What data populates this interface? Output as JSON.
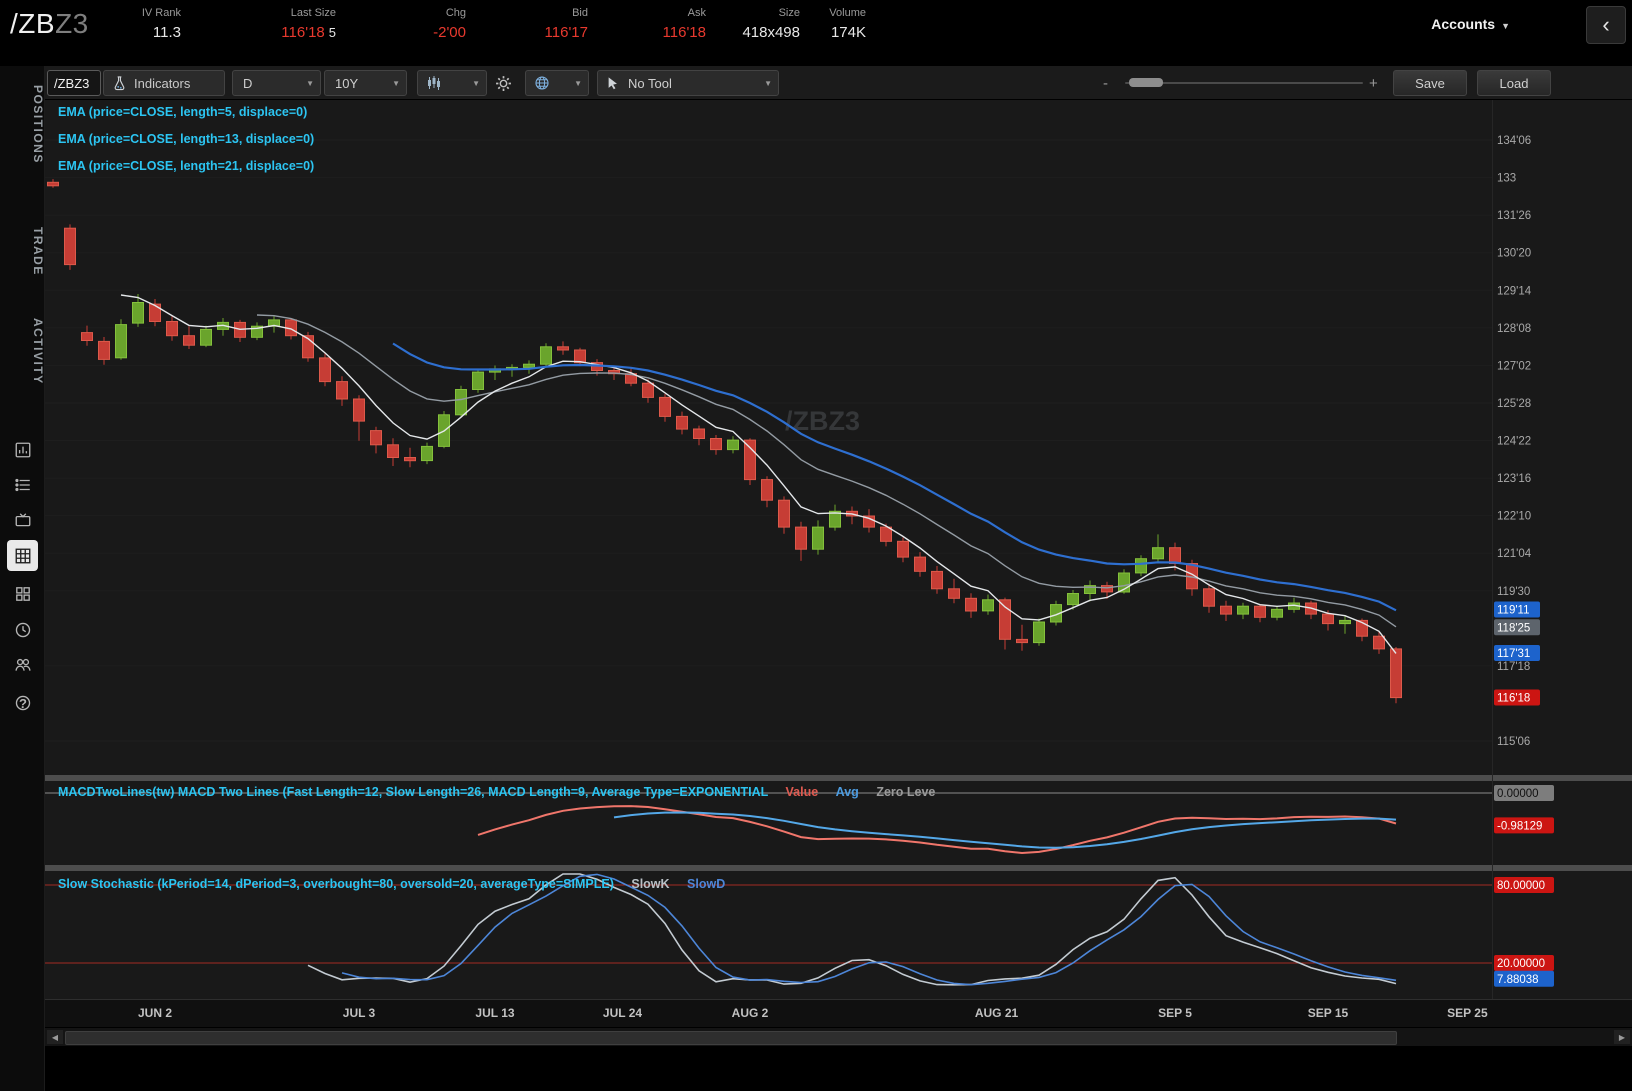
{
  "header": {
    "symbol_main": "/ZB",
    "symbol_suffix": "Z3",
    "stats": [
      {
        "label": "IV Rank",
        "value": "11.3"
      },
      {
        "label": "Last Size",
        "value": "116'18",
        "value2": "5"
      },
      {
        "label": "Chg",
        "value": "-2'00"
      },
      {
        "label": "Bid",
        "value": "116'17"
      },
      {
        "label": "Ask",
        "value": "116'18"
      },
      {
        "label": "Size",
        "value": "418x498"
      },
      {
        "label": "Volume",
        "value": "174K"
      }
    ],
    "accounts_label": "Accounts"
  },
  "icons": {
    "caret": "▼",
    "chevron_left": "‹",
    "scroll_left": "◀",
    "scroll_right": "▶",
    "zoom_minus": "-",
    "zoom_plus": "+"
  },
  "sidebar": {
    "tabs": [
      "POSITIONS",
      "TRADE",
      "ACTIVITY"
    ],
    "icon_names": [
      "chart-report-icon",
      "order-list-icon",
      "tv-icon",
      "chart-grid-icon",
      "apps-icon",
      "history-clock-icon",
      "community-icon",
      "help-icon"
    ]
  },
  "toolbar": {
    "symbol_input": "/ZBZ3",
    "indicators_label": "Indicators",
    "aggregation": "D",
    "range": "10Y",
    "tool_label": "No Tool",
    "save_label": "Save",
    "load_label": "Load"
  },
  "chart_data": {
    "type": "candlestick",
    "symbol": "/ZBZ3",
    "watermark": "/ZBZ3",
    "studies": {
      "ema_labels": [
        "EMA (price=CLOSE, length=5, displace=0)",
        "EMA (price=CLOSE, length=13, displace=0)",
        "EMA (price=CLOSE, length=21, displace=0)"
      ],
      "macd_title": "MACDTwoLines(tw) MACD Two Lines (Fast Length=12, Slow Length=26, MACD Length=9, Average Type=EXPONENTIAL",
      "macd_legend": {
        "value": "Value",
        "avg": "Avg",
        "zero": "Zero Leve"
      },
      "stoch_title": "Slow Stochastic (kPeriod=14, dPeriod=3, overbought=80, oversold=20, averageType=SIMPLE)",
      "stoch_legend": {
        "k": "SlowK",
        "d": "SlowD"
      }
    },
    "colors": {
      "up": "#6aa42c",
      "up_edge": "#85c13c",
      "down": "#c63d35",
      "down_edge": "#dd5a4b",
      "ema5": "#e4e7ea",
      "ema13": "#939ba3",
      "ema21": "#2e6fd0",
      "macd_value": "#f0766b",
      "macd_avg": "#54a8e8",
      "stoch_k": "#c3cbd2",
      "stoch_d": "#4d86d8",
      "level_red": "#a42a22",
      "zero_gray": "#8a8a8a"
    },
    "y_ticks": [
      {
        "label": "134'06",
        "price": 134.1875
      },
      {
        "label": "133",
        "price": 133.0
      },
      {
        "label": "131'26",
        "price": 131.8125
      },
      {
        "label": "130'20",
        "price": 130.625
      },
      {
        "label": "129'14",
        "price": 129.4375
      },
      {
        "label": "128'08",
        "price": 128.25
      },
      {
        "label": "127'02",
        "price": 127.0625
      },
      {
        "label": "125'28",
        "price": 125.875
      },
      {
        "label": "124'22",
        "price": 124.6875
      },
      {
        "label": "123'16",
        "price": 123.5
      },
      {
        "label": "122'10",
        "price": 122.3125
      },
      {
        "label": "121'04",
        "price": 121.125
      },
      {
        "label": "119'30",
        "price": 119.9375
      },
      {
        "label": "117'18",
        "price": 117.5625
      },
      {
        "label": "115'06",
        "price": 115.1875
      }
    ],
    "x_ticks": [
      {
        "label": "JUN 2",
        "ci": 6
      },
      {
        "label": "JUL 3",
        "ci": 18
      },
      {
        "label": "JUL 13",
        "ci": 26
      },
      {
        "label": "JUL 24",
        "ci": 33.5
      },
      {
        "label": "AUG 2",
        "ci": 41
      },
      {
        "label": "AUG 21",
        "ci": 55.5
      },
      {
        "label": "SEP 5",
        "ci": 66
      },
      {
        "label": "SEP 15",
        "ci": 75
      },
      {
        "label": "SEP 25",
        "ci": 83.2
      }
    ],
    "price_bubbles": [
      {
        "label": "119'11",
        "price": 119.34375,
        "style": "blue"
      },
      {
        "label": "118'25",
        "price": 118.78125,
        "style": "gray"
      },
      {
        "label": "117'31",
        "price": 117.96875,
        "style": "blue"
      },
      {
        "label": "116'18",
        "price": 116.5625,
        "style": "red"
      }
    ],
    "macd_labels": {
      "zero": "0.00000",
      "last": "-0.98129",
      "last_value": -0.98129
    },
    "stoch_labels": {
      "overbought": "80.00000",
      "oversold": "20.00000",
      "last": "7.88038",
      "last_value": 7.88038
    },
    "candles": [
      [
        132.85,
        132.95,
        132.68,
        132.74
      ],
      [
        131.4,
        131.52,
        130.08,
        130.25
      ],
      [
        128.1,
        128.32,
        127.68,
        127.85
      ],
      [
        127.82,
        127.96,
        127.08,
        127.25
      ],
      [
        127.3,
        128.52,
        127.24,
        128.35
      ],
      [
        128.4,
        129.32,
        128.28,
        129.05
      ],
      [
        129.0,
        129.16,
        128.3,
        128.45
      ],
      [
        128.45,
        128.62,
        127.84,
        128.0
      ],
      [
        128.0,
        128.3,
        127.58,
        127.7
      ],
      [
        127.7,
        128.32,
        127.64,
        128.2
      ],
      [
        128.2,
        128.56,
        128.0,
        128.42
      ],
      [
        128.42,
        128.5,
        127.8,
        127.95
      ],
      [
        127.95,
        128.42,
        127.86,
        128.3
      ],
      [
        128.3,
        128.62,
        128.1,
        128.5
      ],
      [
        128.5,
        128.56,
        127.88,
        128.0
      ],
      [
        128.0,
        128.12,
        127.18,
        127.3
      ],
      [
        127.3,
        127.46,
        126.4,
        126.55
      ],
      [
        126.55,
        126.72,
        125.78,
        126.0
      ],
      [
        126.0,
        126.12,
        124.68,
        125.3
      ],
      [
        125.0,
        125.12,
        124.28,
        124.55
      ],
      [
        124.55,
        124.76,
        123.88,
        124.15
      ],
      [
        124.15,
        124.46,
        123.84,
        124.05
      ],
      [
        124.05,
        124.62,
        123.94,
        124.5
      ],
      [
        124.5,
        125.62,
        124.44,
        125.5
      ],
      [
        125.5,
        126.42,
        125.44,
        126.3
      ],
      [
        126.3,
        126.96,
        126.2,
        126.85
      ],
      [
        126.85,
        127.06,
        126.6,
        126.95
      ],
      [
        126.95,
        127.1,
        126.7,
        127.0
      ],
      [
        127.0,
        127.22,
        126.8,
        127.1
      ],
      [
        127.1,
        127.76,
        127.0,
        127.65
      ],
      [
        127.65,
        127.82,
        127.4,
        127.55
      ],
      [
        127.55,
        127.62,
        127.04,
        127.15
      ],
      [
        127.15,
        127.26,
        126.74,
        126.9
      ],
      [
        126.9,
        127.02,
        126.6,
        126.8
      ],
      [
        126.8,
        126.96,
        126.4,
        126.5
      ],
      [
        126.5,
        126.62,
        125.88,
        126.05
      ],
      [
        126.05,
        126.16,
        125.28,
        125.45
      ],
      [
        125.45,
        125.6,
        124.88,
        125.05
      ],
      [
        125.05,
        125.16,
        124.54,
        124.75
      ],
      [
        124.75,
        124.86,
        124.24,
        124.4
      ],
      [
        124.4,
        124.82,
        124.28,
        124.7
      ],
      [
        124.7,
        124.76,
        123.28,
        123.45
      ],
      [
        123.45,
        123.56,
        122.58,
        122.8
      ],
      [
        122.8,
        122.92,
        121.74,
        121.95
      ],
      [
        121.95,
        122.12,
        120.88,
        121.25
      ],
      [
        121.25,
        122.16,
        121.08,
        121.95
      ],
      [
        121.95,
        122.66,
        121.84,
        122.45
      ],
      [
        122.45,
        122.6,
        122.04,
        122.3
      ],
      [
        122.3,
        122.52,
        121.78,
        121.95
      ],
      [
        121.95,
        122.06,
        121.34,
        121.5
      ],
      [
        121.5,
        121.62,
        120.84,
        121.0
      ],
      [
        121.0,
        121.16,
        120.38,
        120.55
      ],
      [
        120.55,
        120.72,
        119.84,
        120.0
      ],
      [
        120.0,
        120.32,
        119.54,
        119.7
      ],
      [
        119.7,
        119.86,
        119.08,
        119.3
      ],
      [
        119.3,
        119.82,
        119.18,
        119.65
      ],
      [
        119.65,
        119.72,
        118.08,
        118.4
      ],
      [
        118.4,
        118.86,
        118.04,
        118.3
      ],
      [
        118.3,
        119.06,
        118.2,
        118.95
      ],
      [
        118.95,
        119.62,
        118.84,
        119.5
      ],
      [
        119.5,
        119.96,
        119.34,
        119.85
      ],
      [
        119.85,
        120.26,
        119.6,
        120.1
      ],
      [
        120.1,
        120.22,
        119.68,
        119.9
      ],
      [
        119.9,
        120.62,
        119.84,
        120.5
      ],
      [
        120.5,
        121.06,
        120.4,
        120.95
      ],
      [
        120.95,
        121.72,
        120.84,
        121.3
      ],
      [
        121.3,
        121.46,
        120.58,
        120.8
      ],
      [
        120.8,
        120.92,
        119.78,
        120.0
      ],
      [
        120.0,
        120.16,
        119.24,
        119.45
      ],
      [
        119.45,
        119.62,
        118.98,
        119.2
      ],
      [
        119.2,
        119.56,
        119.04,
        119.45
      ],
      [
        119.45,
        119.52,
        118.94,
        119.1
      ],
      [
        119.1,
        119.46,
        119.0,
        119.35
      ],
      [
        119.35,
        119.72,
        119.24,
        119.55
      ],
      [
        119.55,
        119.62,
        119.04,
        119.2
      ],
      [
        119.2,
        119.32,
        118.68,
        118.9
      ],
      [
        118.9,
        119.16,
        118.58,
        119.0
      ],
      [
        119.0,
        119.06,
        118.34,
        118.5
      ],
      [
        118.5,
        118.66,
        117.94,
        118.1
      ],
      [
        118.1,
        118.16,
        116.38,
        116.56
      ]
    ]
  }
}
